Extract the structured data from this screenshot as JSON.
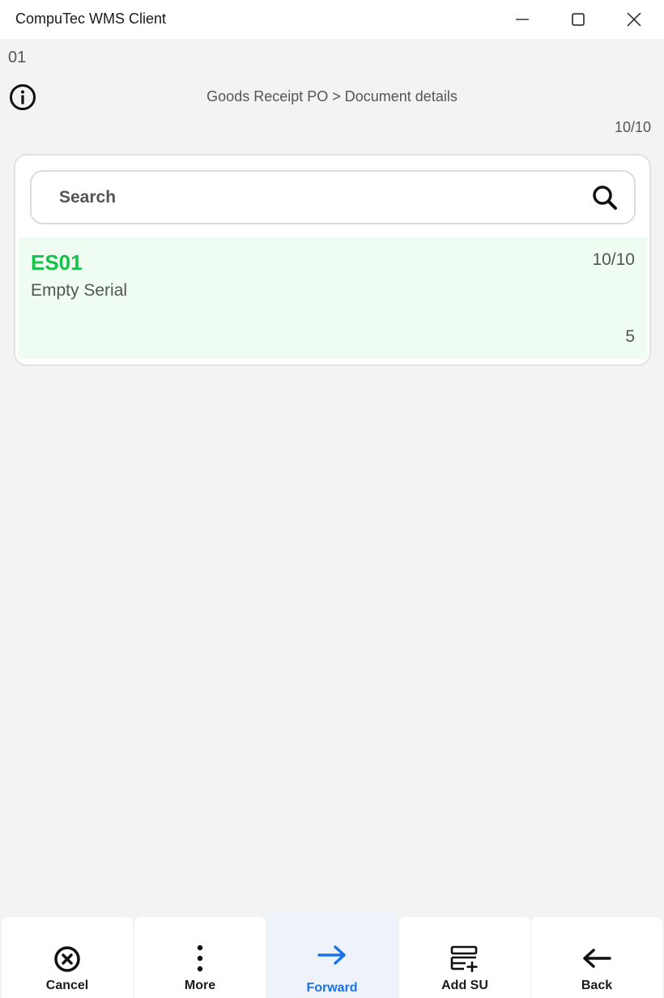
{
  "window": {
    "title": "CompuTec WMS Client"
  },
  "header": {
    "company": "01",
    "breadcrumb": "Goods Receipt PO > Document details",
    "count": "10/10"
  },
  "search": {
    "placeholder": "Search"
  },
  "items": [
    {
      "code": "ES01",
      "description": "Empty Serial",
      "quantity": "10/10",
      "number": "5"
    }
  ],
  "bottom_bar": {
    "buttons": [
      {
        "label": "Cancel",
        "icon": "cancel-circle-icon"
      },
      {
        "label": "More",
        "icon": "more-vertical-icon"
      },
      {
        "label": "Forward",
        "icon": "arrow-right-icon",
        "active": true
      },
      {
        "label": "Add SU",
        "icon": "add-storage-unit-icon"
      },
      {
        "label": "Back",
        "icon": "arrow-left-icon"
      }
    ]
  },
  "colors": {
    "accent": "#1a73e8",
    "item_code": "#16c24a",
    "item_background": "#eefcf2"
  }
}
